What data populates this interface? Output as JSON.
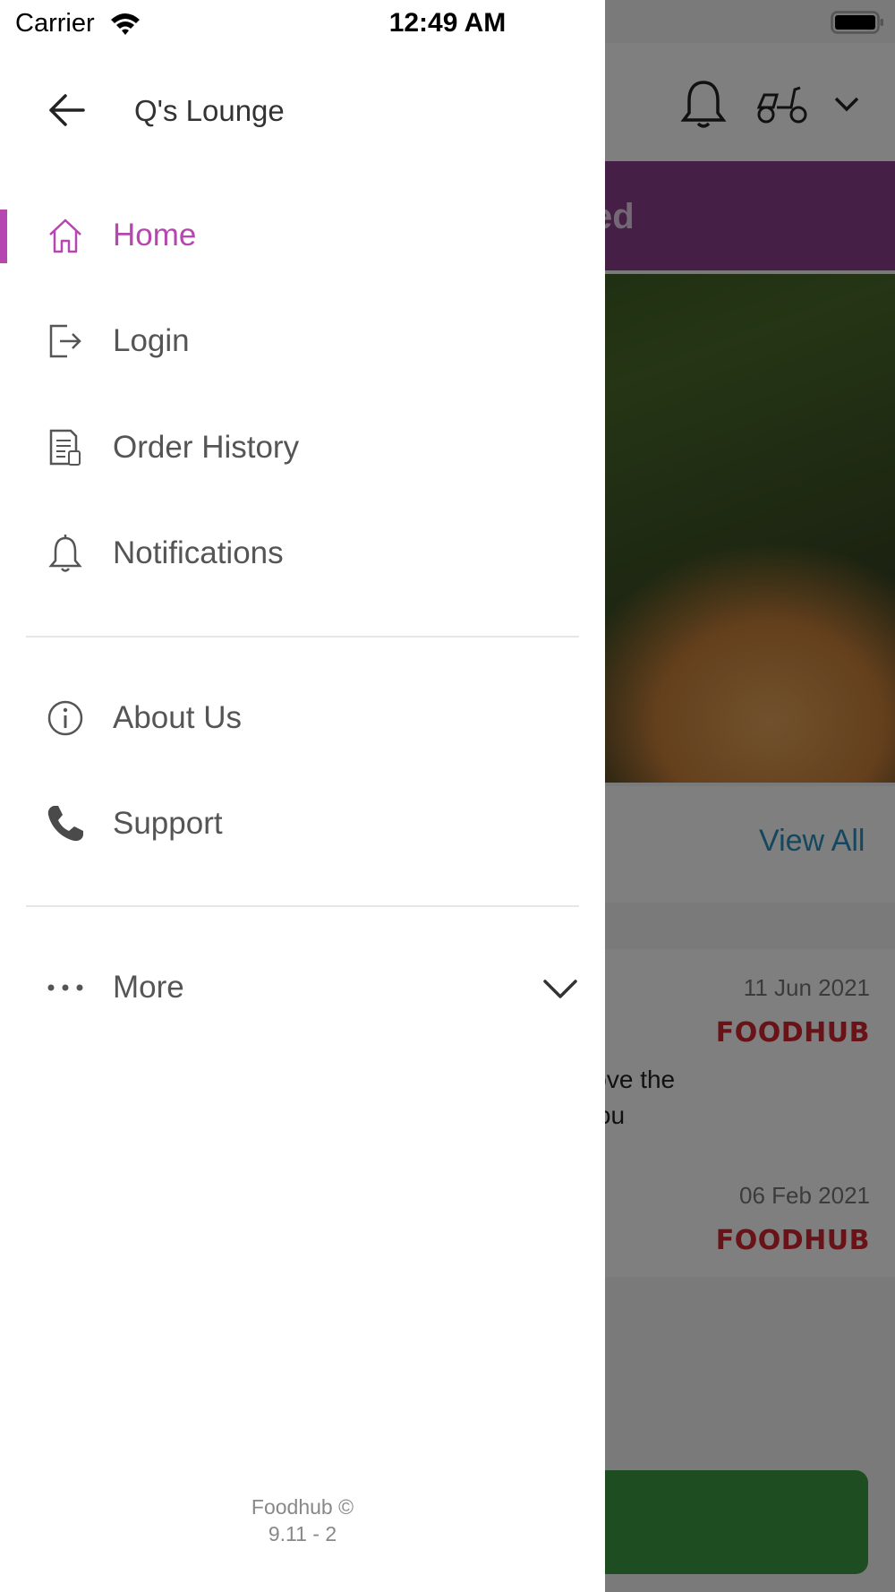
{
  "status_bar": {
    "carrier": "Carrier",
    "time": "12:49 AM"
  },
  "drawer": {
    "store_name": "Q's Lounge",
    "menu_primary": [
      {
        "label": "Home",
        "icon": "home-icon",
        "active": true
      },
      {
        "label": "Login",
        "icon": "login-icon",
        "active": false
      },
      {
        "label": "Order History",
        "icon": "order-history-icon",
        "active": false
      },
      {
        "label": "Notifications",
        "icon": "bell-icon",
        "active": false
      }
    ],
    "menu_secondary": [
      {
        "label": "About Us",
        "icon": "info-icon"
      },
      {
        "label": "Support",
        "icon": "phone-icon"
      }
    ],
    "more": {
      "label": "More",
      "icon": "more-dots-icon"
    },
    "footer": {
      "line1": "Foodhub ©",
      "line2": "9.11 - 2"
    }
  },
  "background": {
    "banner_text_fragment": "ed",
    "view_all": "View All",
    "reviews": [
      {
        "date": "11 Jun 2021",
        "logo": "FOODHUB",
        "text_line1": "ng. Love the",
        "text_line2": "ank you"
      },
      {
        "date": "06 Feb 2021",
        "logo": "FOODHUB"
      }
    ]
  },
  "colors": {
    "accent": "#b646b0",
    "text_gray": "#555555",
    "banner": "#8a3f8d",
    "link_blue": "#2a8fbf",
    "brand_red": "#d3242e",
    "button_green": "#3e9a45"
  }
}
